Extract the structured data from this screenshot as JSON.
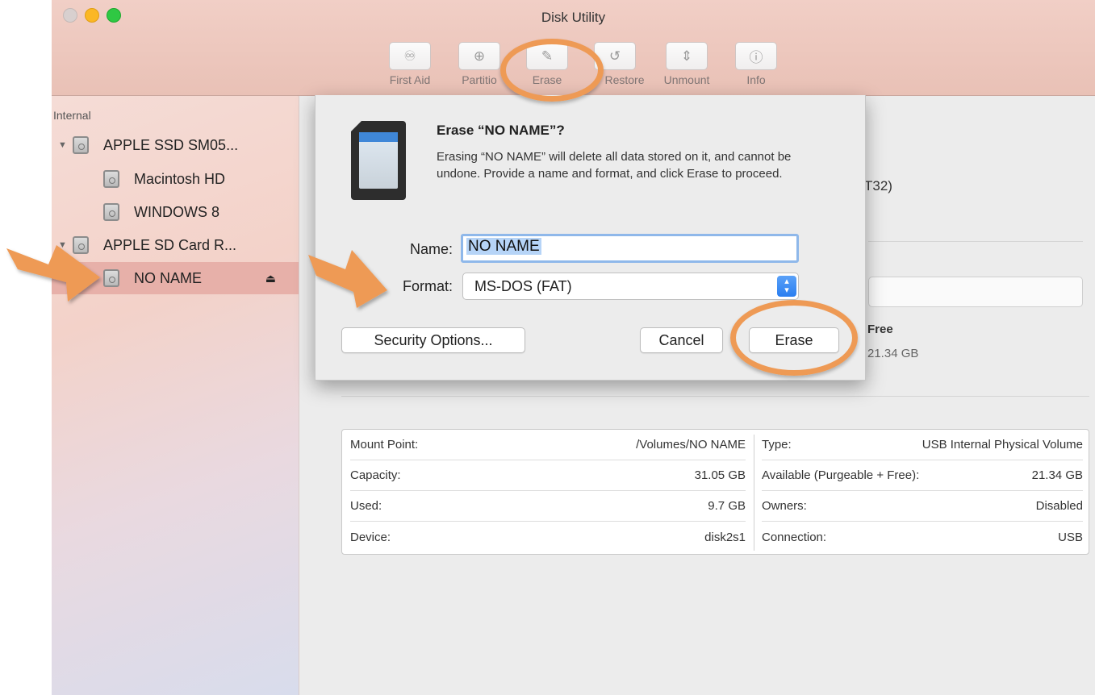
{
  "window": {
    "title": "Disk Utility"
  },
  "toolbar": {
    "buttons": [
      {
        "label": "First Aid",
        "icon": "stethoscope-icon",
        "glyph": "♾"
      },
      {
        "label": "Partitio",
        "icon": "partition-icon",
        "glyph": "⊕"
      },
      {
        "label": "Erase",
        "icon": "erase-icon",
        "glyph": "✎"
      },
      {
        "label": "Restore",
        "icon": "restore-icon",
        "glyph": "↺"
      },
      {
        "label": "Unmount",
        "icon": "unmount-icon",
        "glyph": "⇕"
      },
      {
        "label": "Info",
        "icon": "info-icon",
        "glyph": "ⓘ"
      }
    ]
  },
  "sidebar": {
    "section": "Internal",
    "items": [
      {
        "label": "APPLE SSD SM05...",
        "type": "disk"
      },
      {
        "label": "Macintosh HD",
        "type": "volume"
      },
      {
        "label": "WINDOWS 8",
        "type": "volume"
      },
      {
        "label": "APPLE SD Card R...",
        "type": "disk"
      },
      {
        "label": "NO NAME",
        "type": "volume",
        "selected": true
      }
    ]
  },
  "background_partial": {
    "format_fragment": "T32)",
    "free_label": "Free",
    "free_value": "21.34 GB"
  },
  "dialog": {
    "title": "Erase “NO NAME”?",
    "message": "Erasing “NO NAME” will delete all data stored on it, and cannot be undone. Provide a name and format, and click Erase to proceed.",
    "name_label": "Name:",
    "name_value": "NO NAME",
    "format_label": "Format:",
    "format_value": "MS-DOS (FAT)",
    "security_button": "Security Options...",
    "cancel_button": "Cancel",
    "erase_button": "Erase"
  },
  "info": {
    "left": [
      {
        "key": "Mount Point:",
        "value": "/Volumes/NO NAME"
      },
      {
        "key": "Capacity:",
        "value": "31.05 GB"
      },
      {
        "key": "Used:",
        "value": "9.7 GB"
      },
      {
        "key": "Device:",
        "value": "disk2s1"
      }
    ],
    "right": [
      {
        "key": "Type:",
        "value": "USB Internal Physical Volume"
      },
      {
        "key": "Available (Purgeable + Free):",
        "value": "21.34 GB"
      },
      {
        "key": "Owners:",
        "value": "Disabled"
      },
      {
        "key": "Connection:",
        "value": "USB"
      }
    ]
  },
  "colors": {
    "annotation": "#ee9a55",
    "selection": "#e7b0a9",
    "accent": "#3f87d8"
  }
}
